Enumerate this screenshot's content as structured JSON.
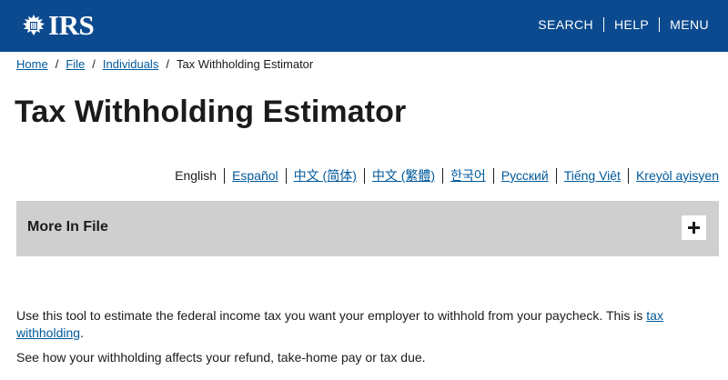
{
  "header": {
    "logo_text": "IRS",
    "nav": [
      "SEARCH",
      "HELP",
      "MENU"
    ]
  },
  "breadcrumb": {
    "items": [
      "Home",
      "File",
      "Individuals"
    ],
    "current": "Tax Withholding Estimator"
  },
  "page": {
    "title": "Tax Withholding Estimator"
  },
  "languages": {
    "current": "English",
    "links": [
      "Español",
      "中文 (简体)",
      "中文 (繁體)",
      "한국어",
      "Русский",
      "Tiếng Việt",
      "Kreyòl ayisyen"
    ]
  },
  "accordion": {
    "title": "More In File"
  },
  "content": {
    "intro": "Use this tool to estimate the federal income tax you want your employer to withhold from your paycheck. This is ",
    "intro_link": "tax withholding",
    "intro_end": ".",
    "sub": "See how your withholding affects your refund, take-home pay or tax due."
  },
  "colors": {
    "header_bg": "#0b4a8f",
    "link": "#00599c",
    "accordion_bg": "#cfcfcf"
  }
}
